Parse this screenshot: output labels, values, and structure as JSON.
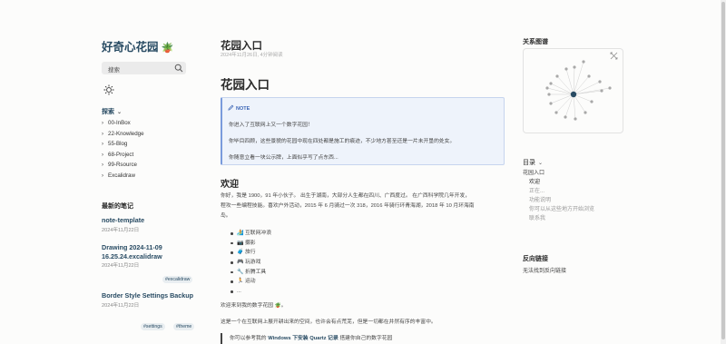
{
  "site": {
    "title": "好奇心花园",
    "title_icon": "potted-plant-icon"
  },
  "search": {
    "placeholder": "搜索"
  },
  "explorer": {
    "heading": "探索",
    "items": [
      "00-InBox",
      "22-Knowledge",
      "55-Blog",
      "68-Project",
      "99-Rsource",
      "Excalidraw"
    ]
  },
  "recent": {
    "heading": "最新的笔记",
    "notes": [
      {
        "title": "note-template",
        "date": "2024年11月22日",
        "tags": []
      },
      {
        "title": "Drawing 2024-11-09 16.25.24.excalidraw",
        "date": "2024年11月22日",
        "tags": [
          "#excalidraw"
        ]
      },
      {
        "title": "Border Style Settings Backup",
        "date": "2024年11月22日",
        "tags": [
          "#settings",
          "#theme"
        ]
      }
    ]
  },
  "page": {
    "title": "花园入口",
    "meta": "2024年11月26日, 4分钟阅读",
    "h1": "花园入口",
    "callout": {
      "label": "NOTE",
      "lines": [
        "你进入了互联网上又一个数字花园！",
        "你毕目四顾，这些景貌的花园中现在四处都是施工的痕迹，不少地方甚至还是一片未开垦的处女。",
        "你随意立看一块公示牌，上面似乎写了点东西..."
      ]
    },
    "h2": "欢迎",
    "intro_lines": [
      "你好，我是 1900，91 年小伙子。 出生于湖南，大部分人生都在四川、广西度过。 在广西科学院几年开发，",
      "程攻一些编程技能。喜欢户外活动，2015 年 6 月骑过一次 318，2016 年骑行环青海湖，2018 年 10 月环海南",
      "岛。"
    ],
    "hobbies": [
      {
        "icon": "🏄",
        "text": "互联网冲浪"
      },
      {
        "icon": "📷",
        "text": "摄影"
      },
      {
        "icon": "🧳",
        "text": "旅行"
      },
      {
        "icon": "🎮",
        "text": "玩游戏"
      },
      {
        "icon": "🔧",
        "text": "折腾工具"
      },
      {
        "icon": "🏃",
        "text": "运动"
      },
      {
        "icon": "",
        "text": "..."
      }
    ],
    "welcome": "欢迎来到我的数字花园 🪴。",
    "desc": "这是一个在互联网上展开耕出来的空间，也许会有点荒芜，但是一切都在井然有序的丰富中。",
    "quote": {
      "prefix": "你可以参考我的 ",
      "link": "Windows 下安装 Quartz 记录",
      "suffix": " 搭建你自己的数字花园"
    }
  },
  "graph": {
    "heading": "关系图谱",
    "toolbar_icon": "expand-graph-icon"
  },
  "toc": {
    "heading": "目录",
    "items": [
      {
        "text": "花园入口",
        "level": 1,
        "active": false
      },
      {
        "text": "欢迎",
        "level": 2,
        "active": true
      },
      {
        "text": "正在...",
        "level": 2,
        "active": false
      },
      {
        "text": "功能说明",
        "level": 2,
        "active": false
      },
      {
        "text": "你可以从这些地方开始浏览",
        "level": 2,
        "active": false
      },
      {
        "text": "联系我",
        "level": 2,
        "active": false
      }
    ]
  },
  "backlinks": {
    "heading": "反向链接",
    "empty": "无法找到反向链接"
  },
  "colors": {
    "accent": "#284b63",
    "callout_bg": "#eef3fb",
    "callout_border": "#7a9bdc",
    "page_bg": "#fcfcfb"
  }
}
